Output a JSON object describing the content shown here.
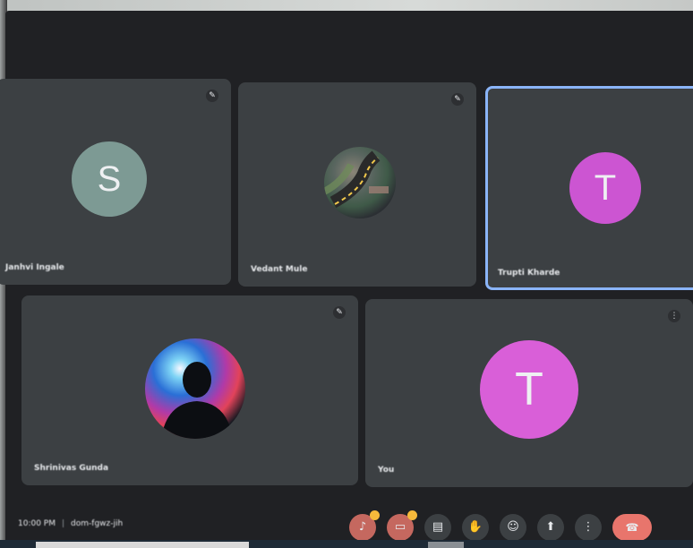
{
  "participants": [
    {
      "name": "Janhvi Ingale",
      "avatar_initial": "S",
      "avatar_color": "#7d9a94",
      "mic_icon": "mic-off-icon"
    },
    {
      "name": "Vedant Mule",
      "avatar_initial": "",
      "avatar_color": "#4f5a55",
      "mic_icon": "mic-off-icon"
    },
    {
      "name": "Trupti Kharde",
      "avatar_initial": "T",
      "avatar_color": "#cc55d2",
      "mic_icon": "",
      "active_speaker": true
    },
    {
      "name": "Shrinivas Gunda",
      "avatar_initial": "",
      "avatar_color": "#101418",
      "mic_icon": "mic-off-icon"
    },
    {
      "name": "You",
      "avatar_initial": "T",
      "avatar_color": "#d95fd8",
      "mic_icon": "more-options-icon"
    }
  ],
  "meeting": {
    "time": "10:00 PM",
    "code": "dom-fgwz-jih"
  },
  "controls": [
    {
      "icon": "mic-off-icon",
      "state": "off",
      "badge": true
    },
    {
      "icon": "camera-off-icon",
      "state": "off",
      "badge": true
    },
    {
      "icon": "captions-icon",
      "state": "on",
      "badge": false
    },
    {
      "icon": "raise-hand-icon",
      "state": "on",
      "badge": false
    },
    {
      "icon": "emoji-icon",
      "state": "on",
      "badge": false
    },
    {
      "icon": "present-screen-icon",
      "state": "on",
      "badge": false
    },
    {
      "icon": "more-options-icon",
      "state": "on",
      "badge": false
    },
    {
      "icon": "hang-up-icon",
      "state": "end",
      "badge": false
    }
  ],
  "colors": {
    "background": "#202124",
    "tile": "#3c4043",
    "active_border": "#8ab4f8",
    "control_off": "#c5685f",
    "hangup": "#e8756c",
    "badge": "#f6b93b"
  }
}
